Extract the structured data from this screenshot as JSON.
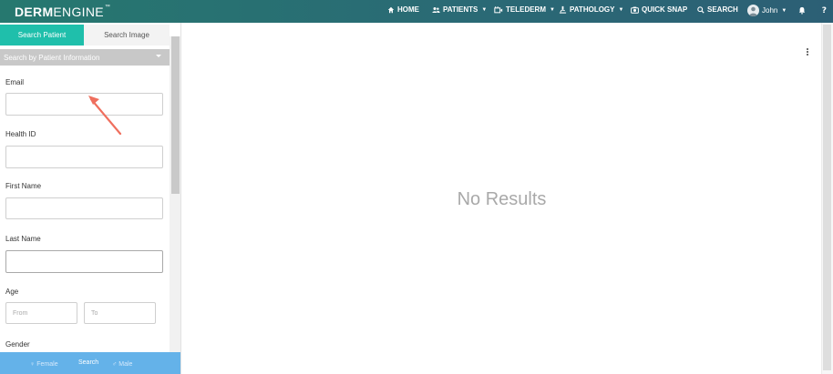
{
  "brand": {
    "bold": "DERM",
    "light": "ENGINE",
    "mark": "™"
  },
  "nav": {
    "home": "HOME",
    "patients": "PATIENTS",
    "telederm": "TELEDERM",
    "pathology": "PATHOLOGY",
    "quick_snap": "QUICK SNAP",
    "search": "SEARCH",
    "user": "John"
  },
  "tabs": {
    "search_patient": "Search Patient",
    "search_image": "Search Image"
  },
  "search_mode": "Search by Patient Information",
  "fields": {
    "email": "Email",
    "health_id": "Health ID",
    "first_name": "First Name",
    "last_name": "Last Name",
    "age": "Age",
    "age_from_placeholder": "From",
    "age_to_placeholder": "To",
    "gender": "Gender",
    "female": "Female",
    "male": "Male"
  },
  "search_button": "Search",
  "main": {
    "no_results": "No Results"
  },
  "colors": {
    "nav_start": "#26786f",
    "nav_end": "#2c5f75",
    "accent": "#1fbfab",
    "search_bar": "#5caee8",
    "annotation_arrow": "#ef6f5e"
  }
}
